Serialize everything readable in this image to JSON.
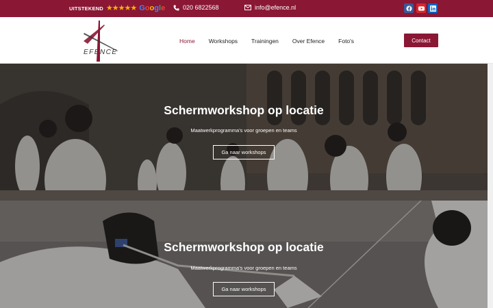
{
  "topbar": {
    "rating_label": "UITSTEKEND",
    "stars": "★★★★★",
    "review_source": "Google",
    "phone": "020 6822568",
    "email": "info@efence.nl",
    "social": [
      "facebook-icon",
      "youtube-icon",
      "linkedin-icon"
    ]
  },
  "logo": {
    "text": "EFENCE"
  },
  "nav": {
    "items": [
      {
        "label": "Home"
      },
      {
        "label": "Workshops"
      },
      {
        "label": "Trainingen"
      },
      {
        "label": "Over Efence"
      },
      {
        "label": "Foto's"
      }
    ],
    "contact_label": "Contact"
  },
  "heroes": [
    {
      "title": "Schermworkshop op locatie",
      "subtitle": "Maatwerkprogramma's voor groepen en teams",
      "cta": "Ga naar workshops"
    },
    {
      "title": "Schermworkshop op locatie",
      "subtitle": "Maatwerkprogramma's voor groepen en teams",
      "cta": "Ga naar workshops"
    }
  ],
  "colors": {
    "brand": "#8a1734",
    "star": "#f5b400",
    "facebook": "#3b5998",
    "youtube": "#d8262c",
    "linkedin": "#0a66c2"
  }
}
